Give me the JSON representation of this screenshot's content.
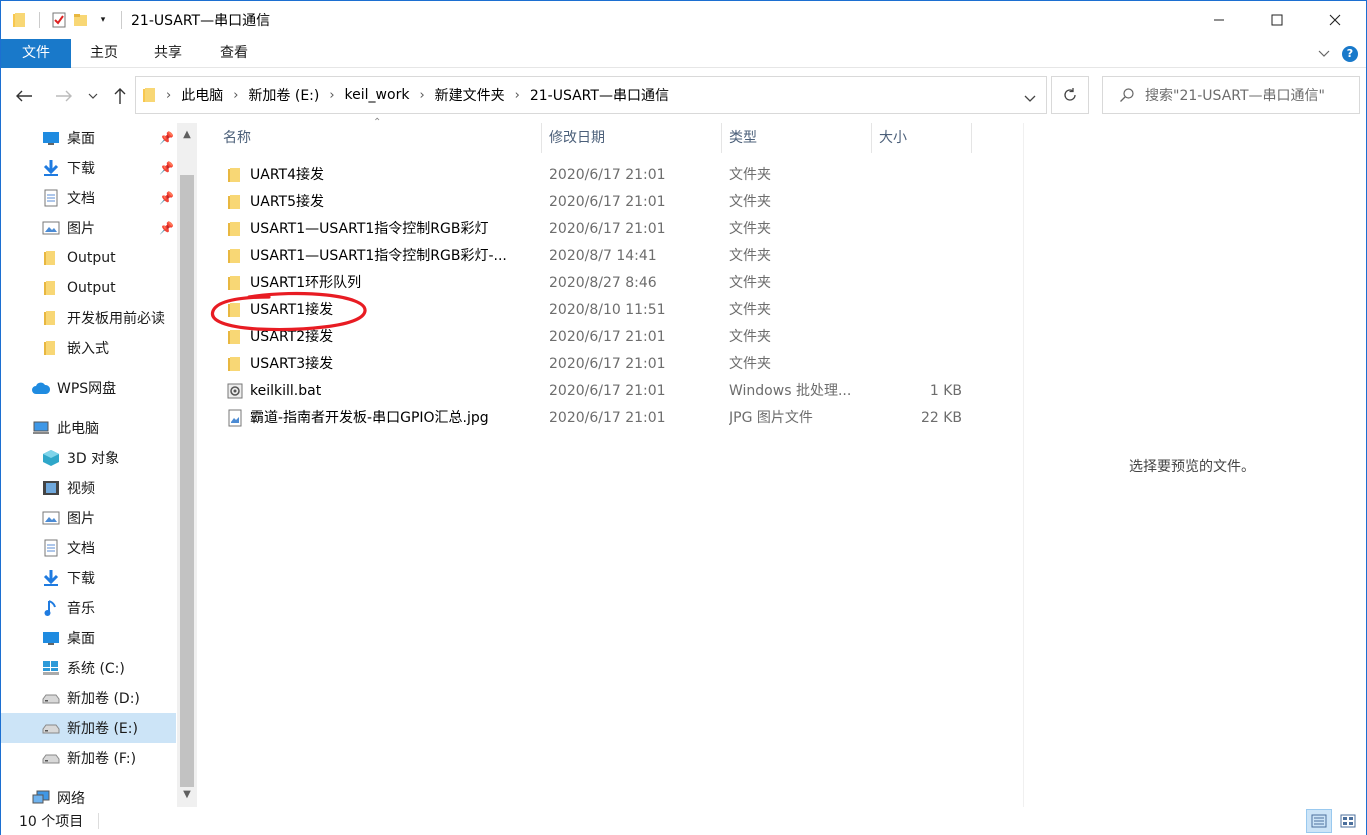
{
  "window": {
    "title": "21-USART—串口通信",
    "colors": {
      "accent": "#1979ca",
      "selection": "#cce4f7",
      "folder": "#f8d775",
      "annotation": "#e81c23"
    }
  },
  "ribbon": {
    "tabs": [
      "文件",
      "主页",
      "共享",
      "查看"
    ]
  },
  "address": {
    "crumbs": [
      "此电脑",
      "新加卷 (E:)",
      "keil_work",
      "新建文件夹",
      "21-USART—串口通信"
    ]
  },
  "search": {
    "placeholder": "搜索\"21-USART—串口通信\""
  },
  "nav": {
    "items": [
      {
        "label": "桌面",
        "icon": "desktop-icon",
        "pinned": true
      },
      {
        "label": "下载",
        "icon": "download-icon",
        "pinned": true
      },
      {
        "label": "文档",
        "icon": "document-icon",
        "pinned": true
      },
      {
        "label": "图片",
        "icon": "pictures-icon",
        "pinned": true
      },
      {
        "label": "Output",
        "icon": "folder-icon"
      },
      {
        "label": "Output",
        "icon": "folder-icon"
      },
      {
        "label": "开发板用前必读",
        "icon": "folder-icon"
      },
      {
        "label": "嵌入式",
        "icon": "folder-icon"
      },
      {
        "label": "WPS网盘",
        "icon": "cloud-icon"
      },
      {
        "label": "此电脑",
        "icon": "computer-icon"
      },
      {
        "label": "3D 对象",
        "icon": "3d-objects-icon"
      },
      {
        "label": "视频",
        "icon": "video-icon"
      },
      {
        "label": "图片",
        "icon": "pictures-icon"
      },
      {
        "label": "文档",
        "icon": "document-icon"
      },
      {
        "label": "下载",
        "icon": "download-icon"
      },
      {
        "label": "音乐",
        "icon": "music-icon"
      },
      {
        "label": "桌面",
        "icon": "desktop-icon"
      },
      {
        "label": "系统 (C:)",
        "icon": "windows-drive-icon"
      },
      {
        "label": "新加卷 (D:)",
        "icon": "drive-icon"
      },
      {
        "label": "新加卷 (E:)",
        "icon": "drive-icon",
        "selected": true
      },
      {
        "label": "新加卷 (F:)",
        "icon": "drive-icon"
      },
      {
        "label": "网络",
        "icon": "network-icon"
      }
    ]
  },
  "columns": {
    "name": "名称",
    "date": "修改日期",
    "type": "类型",
    "size": "大小"
  },
  "files": [
    {
      "name": "UART4接发",
      "date": "2020/6/17 21:01",
      "type": "文件夹",
      "size": "",
      "icon": "folder-icon"
    },
    {
      "name": "UART5接发",
      "date": "2020/6/17 21:01",
      "type": "文件夹",
      "size": "",
      "icon": "folder-icon"
    },
    {
      "name": "USART1—USART1指令控制RGB彩灯",
      "date": "2020/6/17 21:01",
      "type": "文件夹",
      "size": "",
      "icon": "folder-icon"
    },
    {
      "name": "USART1—USART1指令控制RGB彩灯-...",
      "date": "2020/8/7 14:41",
      "type": "文件夹",
      "size": "",
      "icon": "folder-icon"
    },
    {
      "name": "USART1环形队列",
      "date": "2020/8/27 8:46",
      "type": "文件夹",
      "size": "",
      "icon": "folder-icon"
    },
    {
      "name": "USART1接发",
      "date": "2020/8/10 11:51",
      "type": "文件夹",
      "size": "",
      "icon": "folder-icon"
    },
    {
      "name": "USART2接发",
      "date": "2020/6/17 21:01",
      "type": "文件夹",
      "size": "",
      "icon": "folder-icon"
    },
    {
      "name": "USART3接发",
      "date": "2020/6/17 21:01",
      "type": "文件夹",
      "size": "",
      "icon": "folder-icon"
    },
    {
      "name": "keilkill.bat",
      "date": "2020/6/17 21:01",
      "type": "Windows 批处理...",
      "size": "1 KB",
      "icon": "batch-file-icon"
    },
    {
      "name": "霸道-指南者开发板-串口GPIO汇总.jpg",
      "date": "2020/6/17 21:01",
      "type": "JPG 图片文件",
      "size": "22 KB",
      "icon": "image-file-icon"
    }
  ],
  "preview": {
    "message": "选择要预览的文件。"
  },
  "status": {
    "count": "10 个项目"
  }
}
